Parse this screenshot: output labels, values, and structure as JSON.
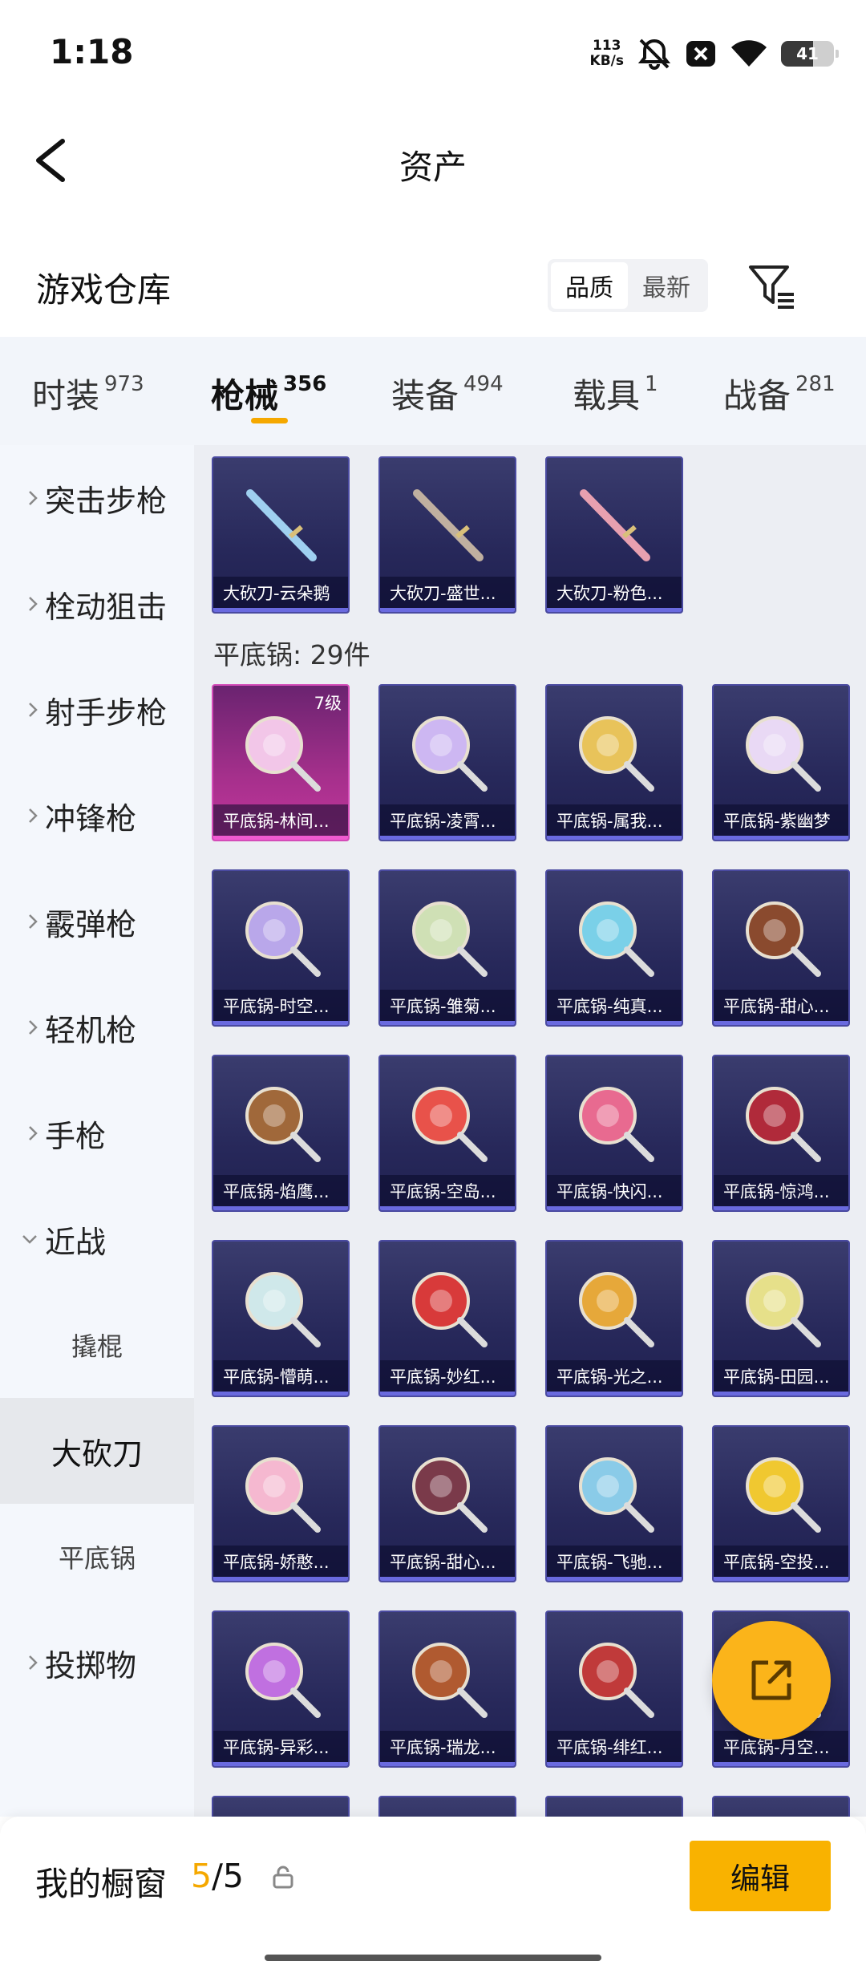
{
  "status": {
    "time": "1:18",
    "net_speed_value": "113",
    "net_speed_unit": "KB/s",
    "battery": "41"
  },
  "header": {
    "title": "资产"
  },
  "warehouse": {
    "title": "游戏仓库",
    "sort_options": [
      "品质",
      "最新"
    ],
    "sort_selected": "品质"
  },
  "tabs": [
    {
      "label": "时装",
      "count": "973"
    },
    {
      "label": "枪械",
      "count": "356",
      "active": true
    },
    {
      "label": "装备",
      "count": "494"
    },
    {
      "label": "载具",
      "count": "1"
    },
    {
      "label": "战备",
      "count": "281"
    }
  ],
  "sidebar": {
    "categories": [
      "突击步枪",
      "栓动狙击",
      "射手步枪",
      "冲锋枪",
      "霰弹枪",
      "轻机枪",
      "手枪",
      "近战"
    ],
    "subcategories": [
      "撬棍",
      "大砍刀",
      "平底锅"
    ],
    "selected_sub": "大砍刀",
    "last_category": "投掷物"
  },
  "grid": {
    "top_items": [
      "大砍刀-云朵鹅",
      "大砍刀-盛世...",
      "大砍刀-粉色..."
    ],
    "section_title": "平底锅: 29件",
    "pan_items": [
      {
        "label": "平底锅-林间...",
        "level": "7级",
        "highlight": true
      },
      {
        "label": "平底锅-凌霄..."
      },
      {
        "label": "平底锅-属我..."
      },
      {
        "label": "平底锅-紫幽梦"
      },
      {
        "label": "平底锅-时空..."
      },
      {
        "label": "平底锅-雏菊..."
      },
      {
        "label": "平底锅-纯真..."
      },
      {
        "label": "平底锅-甜心..."
      },
      {
        "label": "平底锅-焰鹰..."
      },
      {
        "label": "平底锅-空岛..."
      },
      {
        "label": "平底锅-快闪..."
      },
      {
        "label": "平底锅-惊鸿..."
      },
      {
        "label": "平底锅-懵萌..."
      },
      {
        "label": "平底锅-妙红..."
      },
      {
        "label": "平底锅-光之..."
      },
      {
        "label": "平底锅-田园..."
      },
      {
        "label": "平底锅-娇憨..."
      },
      {
        "label": "平底锅-甜心..."
      },
      {
        "label": "平底锅-飞驰..."
      },
      {
        "label": "平底锅-空投..."
      },
      {
        "label": "平底锅-异彩..."
      },
      {
        "label": "平底锅-瑞龙..."
      },
      {
        "label": "平底锅-绯红..."
      },
      {
        "label": "平底锅-月空..."
      }
    ]
  },
  "bottom": {
    "showcase_label": "我的橱窗",
    "showcase_current": "5",
    "showcase_total": "/5",
    "edit_label": "编辑"
  }
}
